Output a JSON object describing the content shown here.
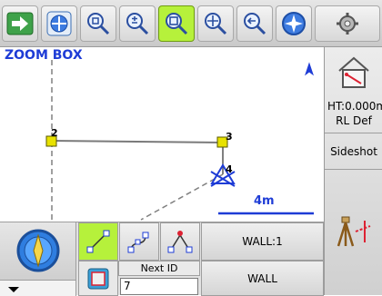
{
  "toolbar": {
    "buttons": [
      {
        "name": "next-arrow-icon"
      },
      {
        "name": "pan-hand-icon"
      },
      {
        "name": "zoom-center-icon"
      },
      {
        "name": "zoom-in-out-icon"
      },
      {
        "name": "zoom-box-icon",
        "active": true
      },
      {
        "name": "zoom-extents-icon"
      },
      {
        "name": "zoom-previous-icon"
      },
      {
        "name": "compass-navigation-icon"
      },
      {
        "name": "settings-icon"
      }
    ]
  },
  "map": {
    "mode_label": "ZOOM BOX",
    "north_label": "A",
    "points": [
      {
        "label": "2"
      },
      {
        "label": "3"
      },
      {
        "label": "4"
      }
    ],
    "scale_label": "4m"
  },
  "right_panel": {
    "height_text": "HT:0.000m",
    "rl_text": "RL Def",
    "sideshot_label": "Sideshot"
  },
  "bottom": {
    "next_id_label": "Next ID",
    "next_id_value": "7",
    "wall_code_label": "WALL:1",
    "wall_button_label": "WALL"
  },
  "colors": {
    "accent_green": "#b6f13b",
    "map_blue": "#1e3cd6",
    "point_yellow": "#e8e200"
  }
}
